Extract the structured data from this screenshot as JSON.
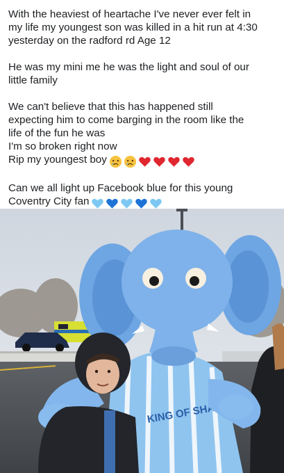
{
  "post": {
    "paragraph_1": [
      "With the heaviest of heartache I've never ever felt in",
      "my life my youngest son was killed in a hit run at 4:30",
      "yesterday on the radford rd  Age 12"
    ],
    "paragraph_2": [
      "He was my mini me  he was the light and soul of our",
      "little family"
    ],
    "paragraph_3": [
      "We can't believe that this has happened still",
      "expecting him to come barging in the room like the",
      "life of the fun he was",
      "I'm so broken right now",
      "Rip my youngest boy"
    ],
    "paragraph_3_emojis": [
      "crying-face",
      "crying-face",
      "red-heart",
      "red-heart",
      "red-heart",
      "red-heart"
    ],
    "paragraph_4": [
      "Can we all light up Facebook blue for this young",
      "Coventry City fan"
    ],
    "paragraph_4_emojis": [
      "light-blue-heart",
      "blue-heart",
      "light-blue-heart",
      "blue-heart",
      "light-blue-heart"
    ]
  },
  "photo": {
    "shirt_sponsor_text": "KING OF SHAVES",
    "mascot_color": "#7fb2ea",
    "shirt_color": "#8fc4ef"
  },
  "colors": {
    "text": "#1c1e21",
    "red_heart": "#e0262f",
    "light_blue_heart": "#7dc8f2",
    "blue_heart": "#1e73d6",
    "emoji_face": "#f6c23e"
  }
}
